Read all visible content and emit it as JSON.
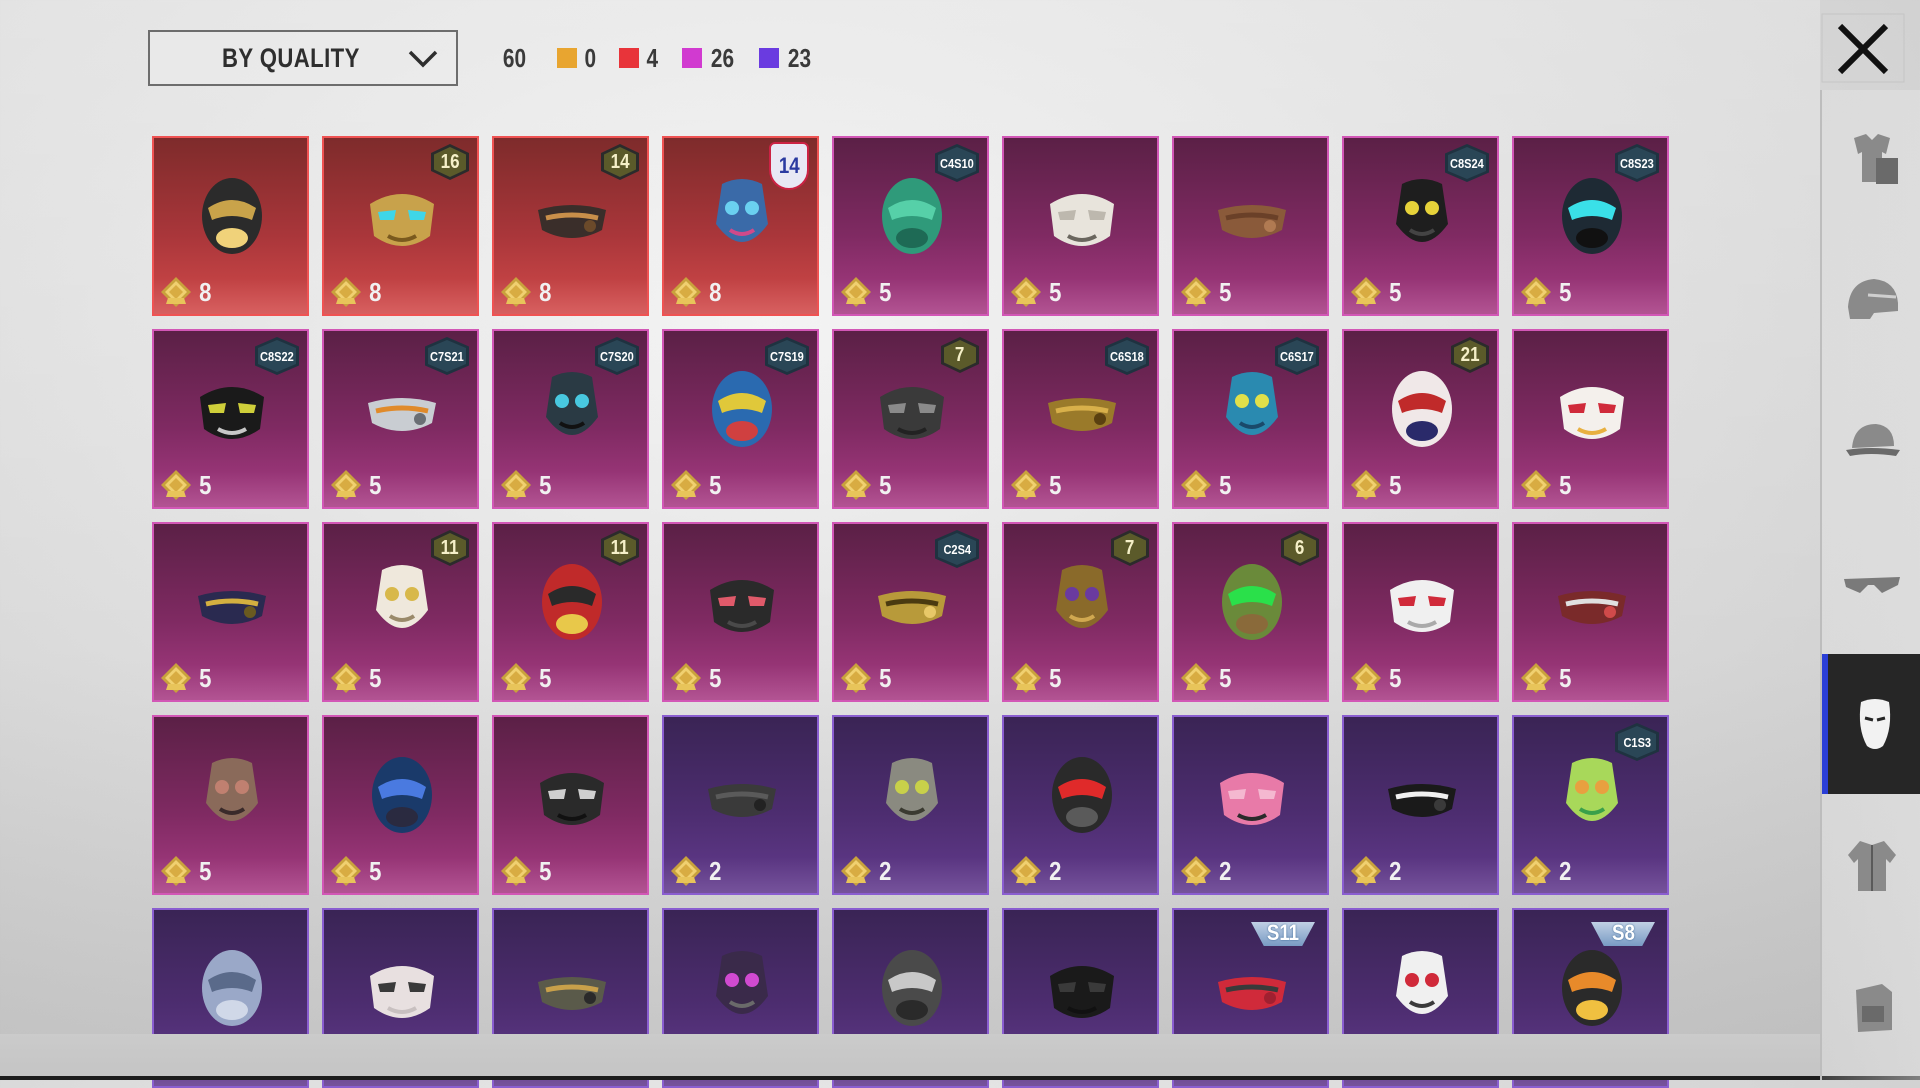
{
  "toolbar": {
    "sort_label": "BY QUALITY",
    "total_count": "60",
    "quality_counts": [
      {
        "label": "0",
        "color": "#e8a530"
      },
      {
        "label": "4",
        "color": "#e8343a"
      },
      {
        "label": "26",
        "color": "#d13ad0"
      },
      {
        "label": "23",
        "color": "#6a3be0"
      }
    ]
  },
  "colors": {
    "red_quality": "#d24a4a",
    "pink_quality": "#a83c84",
    "purple_quality": "#633b8e",
    "sidebar_active_accent": "#2a3ed6"
  },
  "items": [
    {
      "name": "mask-skull-helmet",
      "quality": "red",
      "price": "8",
      "icon": "black-gold-helmet-mask-icon"
    },
    {
      "name": "mask-gold-cyan-helmet",
      "quality": "red",
      "price": "8",
      "badge_type": "lvl",
      "badge": "16",
      "icon": "gold-cyan-helmet-icon"
    },
    {
      "name": "mask-gold-face-guard",
      "quality": "red",
      "price": "8",
      "badge_type": "lvl",
      "badge": "14",
      "icon": "gold-face-guard-icon"
    },
    {
      "name": "mask-blue-robot-helmet",
      "quality": "red",
      "price": "8",
      "badge_type": "shield",
      "badge": "14",
      "icon": "blue-robot-helmet-icon"
    },
    {
      "name": "mask-green-face",
      "quality": "pink",
      "price": "5",
      "badge_type": "hex",
      "badge": "C4S10",
      "icon": "green-half-mask-icon"
    },
    {
      "name": "mask-cat",
      "quality": "pink",
      "price": "5",
      "icon": "cat-mask-icon"
    },
    {
      "name": "mask-brown-bandana",
      "quality": "pink",
      "price": "5",
      "icon": "brown-bandana-icon"
    },
    {
      "name": "mask-yellow-fangs",
      "quality": "pink",
      "price": "5",
      "badge_type": "hex",
      "badge": "C8S24",
      "icon": "yellow-fangs-mask-icon"
    },
    {
      "name": "mask-cyan-neon",
      "quality": "pink",
      "price": "5",
      "badge_type": "hex",
      "badge": "C8S23",
      "icon": "cyan-neon-mask-icon"
    },
    {
      "name": "mask-black-respirator",
      "quality": "pink",
      "price": "5",
      "badge_type": "hex",
      "badge": "C8S22",
      "icon": "black-respirator-icon"
    },
    {
      "name": "mask-white-tech",
      "quality": "pink",
      "price": "5",
      "badge_type": "hex",
      "badge": "C7S21",
      "icon": "white-tech-mask-icon"
    },
    {
      "name": "mask-cyan-black",
      "quality": "pink",
      "price": "5",
      "badge_type": "hex",
      "badge": "C7S20",
      "icon": "cyan-black-mask-icon"
    },
    {
      "name": "mask-graffiti",
      "quality": "pink",
      "price": "5",
      "badge_type": "hex",
      "badge": "C7S19",
      "icon": "graffiti-mask-icon"
    },
    {
      "name": "mask-headset-wire",
      "quality": "pink",
      "price": "5",
      "badge_type": "lvl",
      "badge": "7",
      "icon": "headset-wire-icon"
    },
    {
      "name": "mask-gold-claws",
      "quality": "pink",
      "price": "5",
      "badge_type": "hex",
      "badge": "C6S18",
      "icon": "gold-claw-mask-icon"
    },
    {
      "name": "mask-teal-pattern",
      "quality": "pink",
      "price": "5",
      "badge_type": "hex",
      "badge": "C6S17",
      "icon": "teal-pattern-mask-icon"
    },
    {
      "name": "mask-clown-grin",
      "quality": "pink",
      "price": "5",
      "badge_type": "lvl",
      "badge": "21",
      "icon": "clown-grin-mask-icon"
    },
    {
      "name": "mask-kitsune",
      "quality": "pink",
      "price": "5",
      "icon": "kitsune-mask-icon"
    },
    {
      "name": "mask-gold-visor",
      "quality": "pink",
      "price": "5",
      "icon": "gold-visor-helmet-icon"
    },
    {
      "name": "mask-white-gold-shard",
      "quality": "pink",
      "price": "5",
      "badge_type": "lvl",
      "badge": "11",
      "icon": "white-gold-shard-icon"
    },
    {
      "name": "mask-red-oni",
      "quality": "pink",
      "price": "5",
      "badge_type": "lvl",
      "badge": "11",
      "icon": "red-oni-mask-icon"
    },
    {
      "name": "mask-glasses-face",
      "quality": "pink",
      "price": "5",
      "icon": "glasses-face-mask-icon"
    },
    {
      "name": "mask-gold-gas",
      "quality": "pink",
      "price": "5",
      "badge_type": "hex",
      "badge": "C2S4",
      "icon": "gold-gas-mask-icon"
    },
    {
      "name": "mask-gold-purple-tribal",
      "quality": "pink",
      "price": "5",
      "badge_type": "lvl",
      "badge": "7",
      "icon": "tribal-mask-icon"
    },
    {
      "name": "mask-tiki-sunglasses",
      "quality": "pink",
      "price": "5",
      "badge_type": "lvl",
      "badge": "6",
      "icon": "tiki-sunglasses-mask-icon"
    },
    {
      "name": "mask-heart-eye",
      "quality": "pink",
      "price": "5",
      "icon": "heart-eye-mask-icon"
    },
    {
      "name": "mask-skull-bandana",
      "quality": "pink",
      "price": "5",
      "icon": "skull-bandana-icon"
    },
    {
      "name": "mask-plague-doctor",
      "quality": "pink",
      "price": "5",
      "icon": "plague-doctor-mask-icon"
    },
    {
      "name": "mask-galaxy-helmet",
      "quality": "pink",
      "price": "5",
      "icon": "galaxy-helmet-icon"
    },
    {
      "name": "mask-skull-scarf",
      "quality": "pink",
      "price": "5",
      "icon": "skull-scarf-icon"
    },
    {
      "name": "mask-black-cloth",
      "quality": "purple",
      "price": "2",
      "icon": "black-cloth-mask-icon"
    },
    {
      "name": "mask-hockey",
      "quality": "purple",
      "price": "2",
      "icon": "hockey-mask-icon"
    },
    {
      "name": "mask-red-eye-visor",
      "quality": "purple",
      "price": "2",
      "icon": "red-eye-visor-icon"
    },
    {
      "name": "mask-pink-dino",
      "quality": "purple",
      "price": "2",
      "icon": "pink-dino-mask-icon"
    },
    {
      "name": "mask-teeth-cloth",
      "quality": "purple",
      "price": "2",
      "icon": "teeth-cloth-mask-icon"
    },
    {
      "name": "mask-cactus-bandana",
      "quality": "purple",
      "price": "2",
      "badge_type": "hex",
      "badge": "C1S3",
      "icon": "cactus-bandana-icon"
    },
    {
      "name": "mask-silver-face",
      "quality": "purple",
      "price": "",
      "icon": "silver-face-mask-icon"
    },
    {
      "name": "mask-white-skull",
      "quality": "purple",
      "price": "",
      "icon": "white-skull-mask-icon"
    },
    {
      "name": "mask-goggles",
      "quality": "purple",
      "price": "",
      "icon": "goggles-mask-icon"
    },
    {
      "name": "mask-pink-gas",
      "quality": "purple",
      "price": "",
      "icon": "pink-gas-mask-icon"
    },
    {
      "name": "mask-respirator-tubes",
      "quality": "purple",
      "price": "",
      "icon": "respirator-tubes-icon"
    },
    {
      "name": "mask-black-half",
      "quality": "purple",
      "price": "",
      "icon": "black-half-mask-icon"
    },
    {
      "name": "mask-red-cloth",
      "quality": "purple",
      "price": "",
      "badge_type": "wing",
      "badge": "S11",
      "icon": "red-cloth-mask-icon"
    },
    {
      "name": "mask-clown-hood",
      "quality": "purple",
      "price": "",
      "icon": "clown-hood-mask-icon"
    },
    {
      "name": "mask-flame-bandana",
      "quality": "purple",
      "price": "",
      "badge_type": "wing",
      "badge": "S8",
      "icon": "flame-bandana-icon"
    }
  ],
  "sidebar": {
    "items": [
      {
        "name": "outfit",
        "icon": "outfit-icon"
      },
      {
        "name": "helmet",
        "icon": "helmet-icon"
      },
      {
        "name": "cap",
        "icon": "cap-icon"
      },
      {
        "name": "glasses",
        "icon": "glasses-icon"
      },
      {
        "name": "mask",
        "icon": "mask-icon",
        "active": true
      },
      {
        "name": "jacket",
        "icon": "jacket-icon"
      },
      {
        "name": "backpack",
        "icon": "backpack-icon"
      }
    ]
  }
}
